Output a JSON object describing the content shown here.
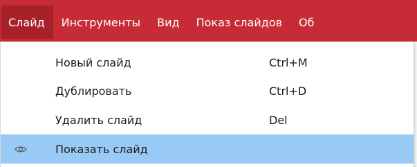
{
  "menubar": {
    "items": [
      {
        "label": "Слайд",
        "active": true
      },
      {
        "label": "Инструменты",
        "active": false
      },
      {
        "label": "Вид",
        "active": false
      },
      {
        "label": "Показ слайдов",
        "active": false
      },
      {
        "label": "Об",
        "active": false
      }
    ]
  },
  "dropdown": {
    "items": [
      {
        "label": "Новый слайд",
        "shortcut": "Ctrl+M",
        "icon": ""
      },
      {
        "label": "Дублировать",
        "shortcut": "Ctrl+D",
        "icon": ""
      },
      {
        "label": "Удалить слайд",
        "shortcut": "Del",
        "icon": ""
      },
      {
        "label": "Показать слайд",
        "shortcut": "",
        "icon": "eye-icon",
        "highlighted": true
      }
    ]
  },
  "colors": {
    "menubar_bg": "#c72c36",
    "menubar_active_bg": "#a8212a",
    "menubar_text": "#ffffff",
    "highlight_bg": "#99c9f5",
    "menu_text": "#1a1a1a"
  }
}
